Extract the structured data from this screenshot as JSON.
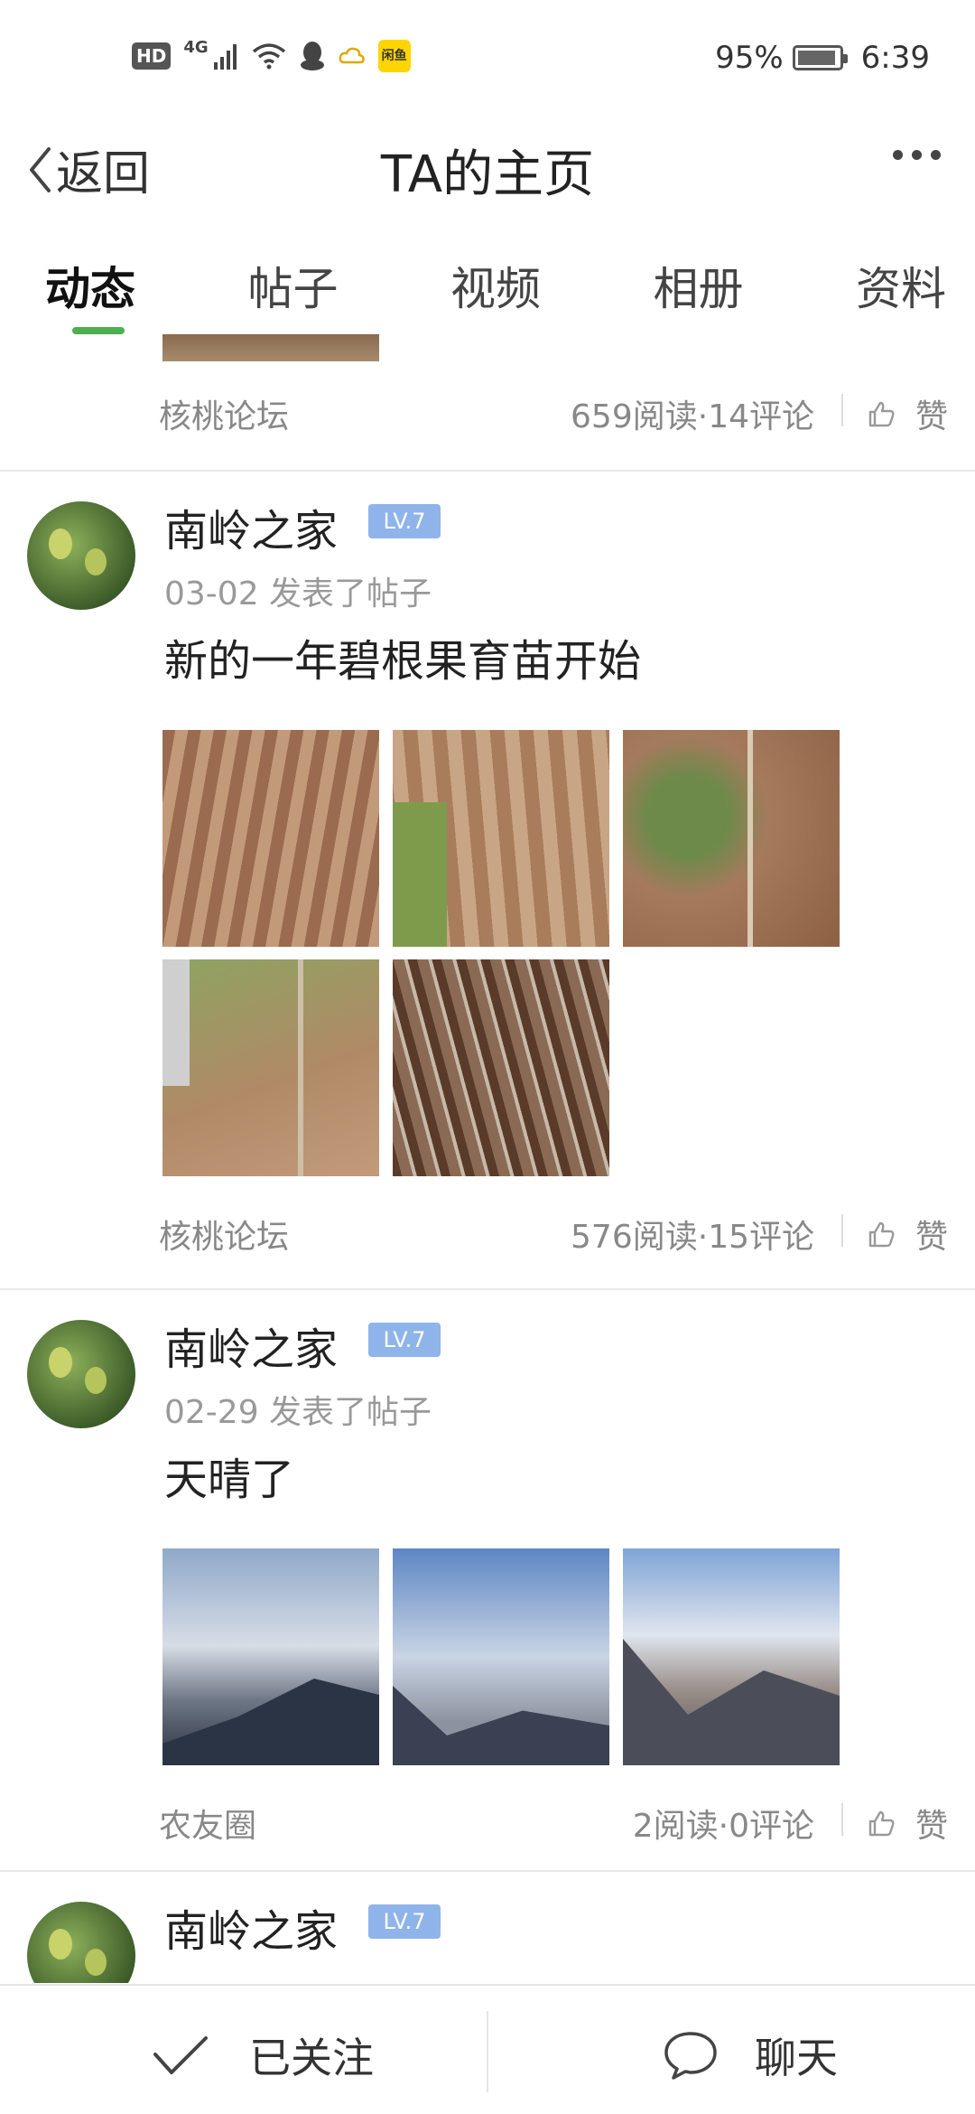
{
  "status_bar": {
    "hd": "HD",
    "network": "4G",
    "app_badge": "闲鱼",
    "battery": "95%",
    "time": "6:39",
    "battery_level": 0.95
  },
  "nav": {
    "back_label": "返回",
    "title": "TA的主页"
  },
  "tabs": [
    {
      "label": "动态",
      "active": true
    },
    {
      "label": "帖子",
      "active": false
    },
    {
      "label": "视频",
      "active": false
    },
    {
      "label": "相册",
      "active": false
    },
    {
      "label": "资料",
      "active": false
    }
  ],
  "posts": [
    {
      "forum": "核桃论坛",
      "stats": "659阅读·14评论",
      "like_label": "赞"
    },
    {
      "author": "南岭之家",
      "level": "LV.7",
      "meta": "03-02 发表了帖子",
      "title": "新的一年碧根果育苗开始",
      "forum": "核桃论坛",
      "stats": "576阅读·15评论",
      "like_label": "赞"
    },
    {
      "author": "南岭之家",
      "level": "LV.7",
      "meta": "02-29 发表了帖子",
      "title": "天晴了",
      "forum": "农友圈",
      "stats": "2阅读·0评论",
      "like_label": "赞"
    },
    {
      "author": "南岭之家",
      "level": "LV.7"
    }
  ],
  "bottom_bar": {
    "follow_label": "已关注",
    "chat_label": "聊天"
  },
  "colors": {
    "accent_green": "#4caf50",
    "level_badge": "#8fb4ea"
  }
}
